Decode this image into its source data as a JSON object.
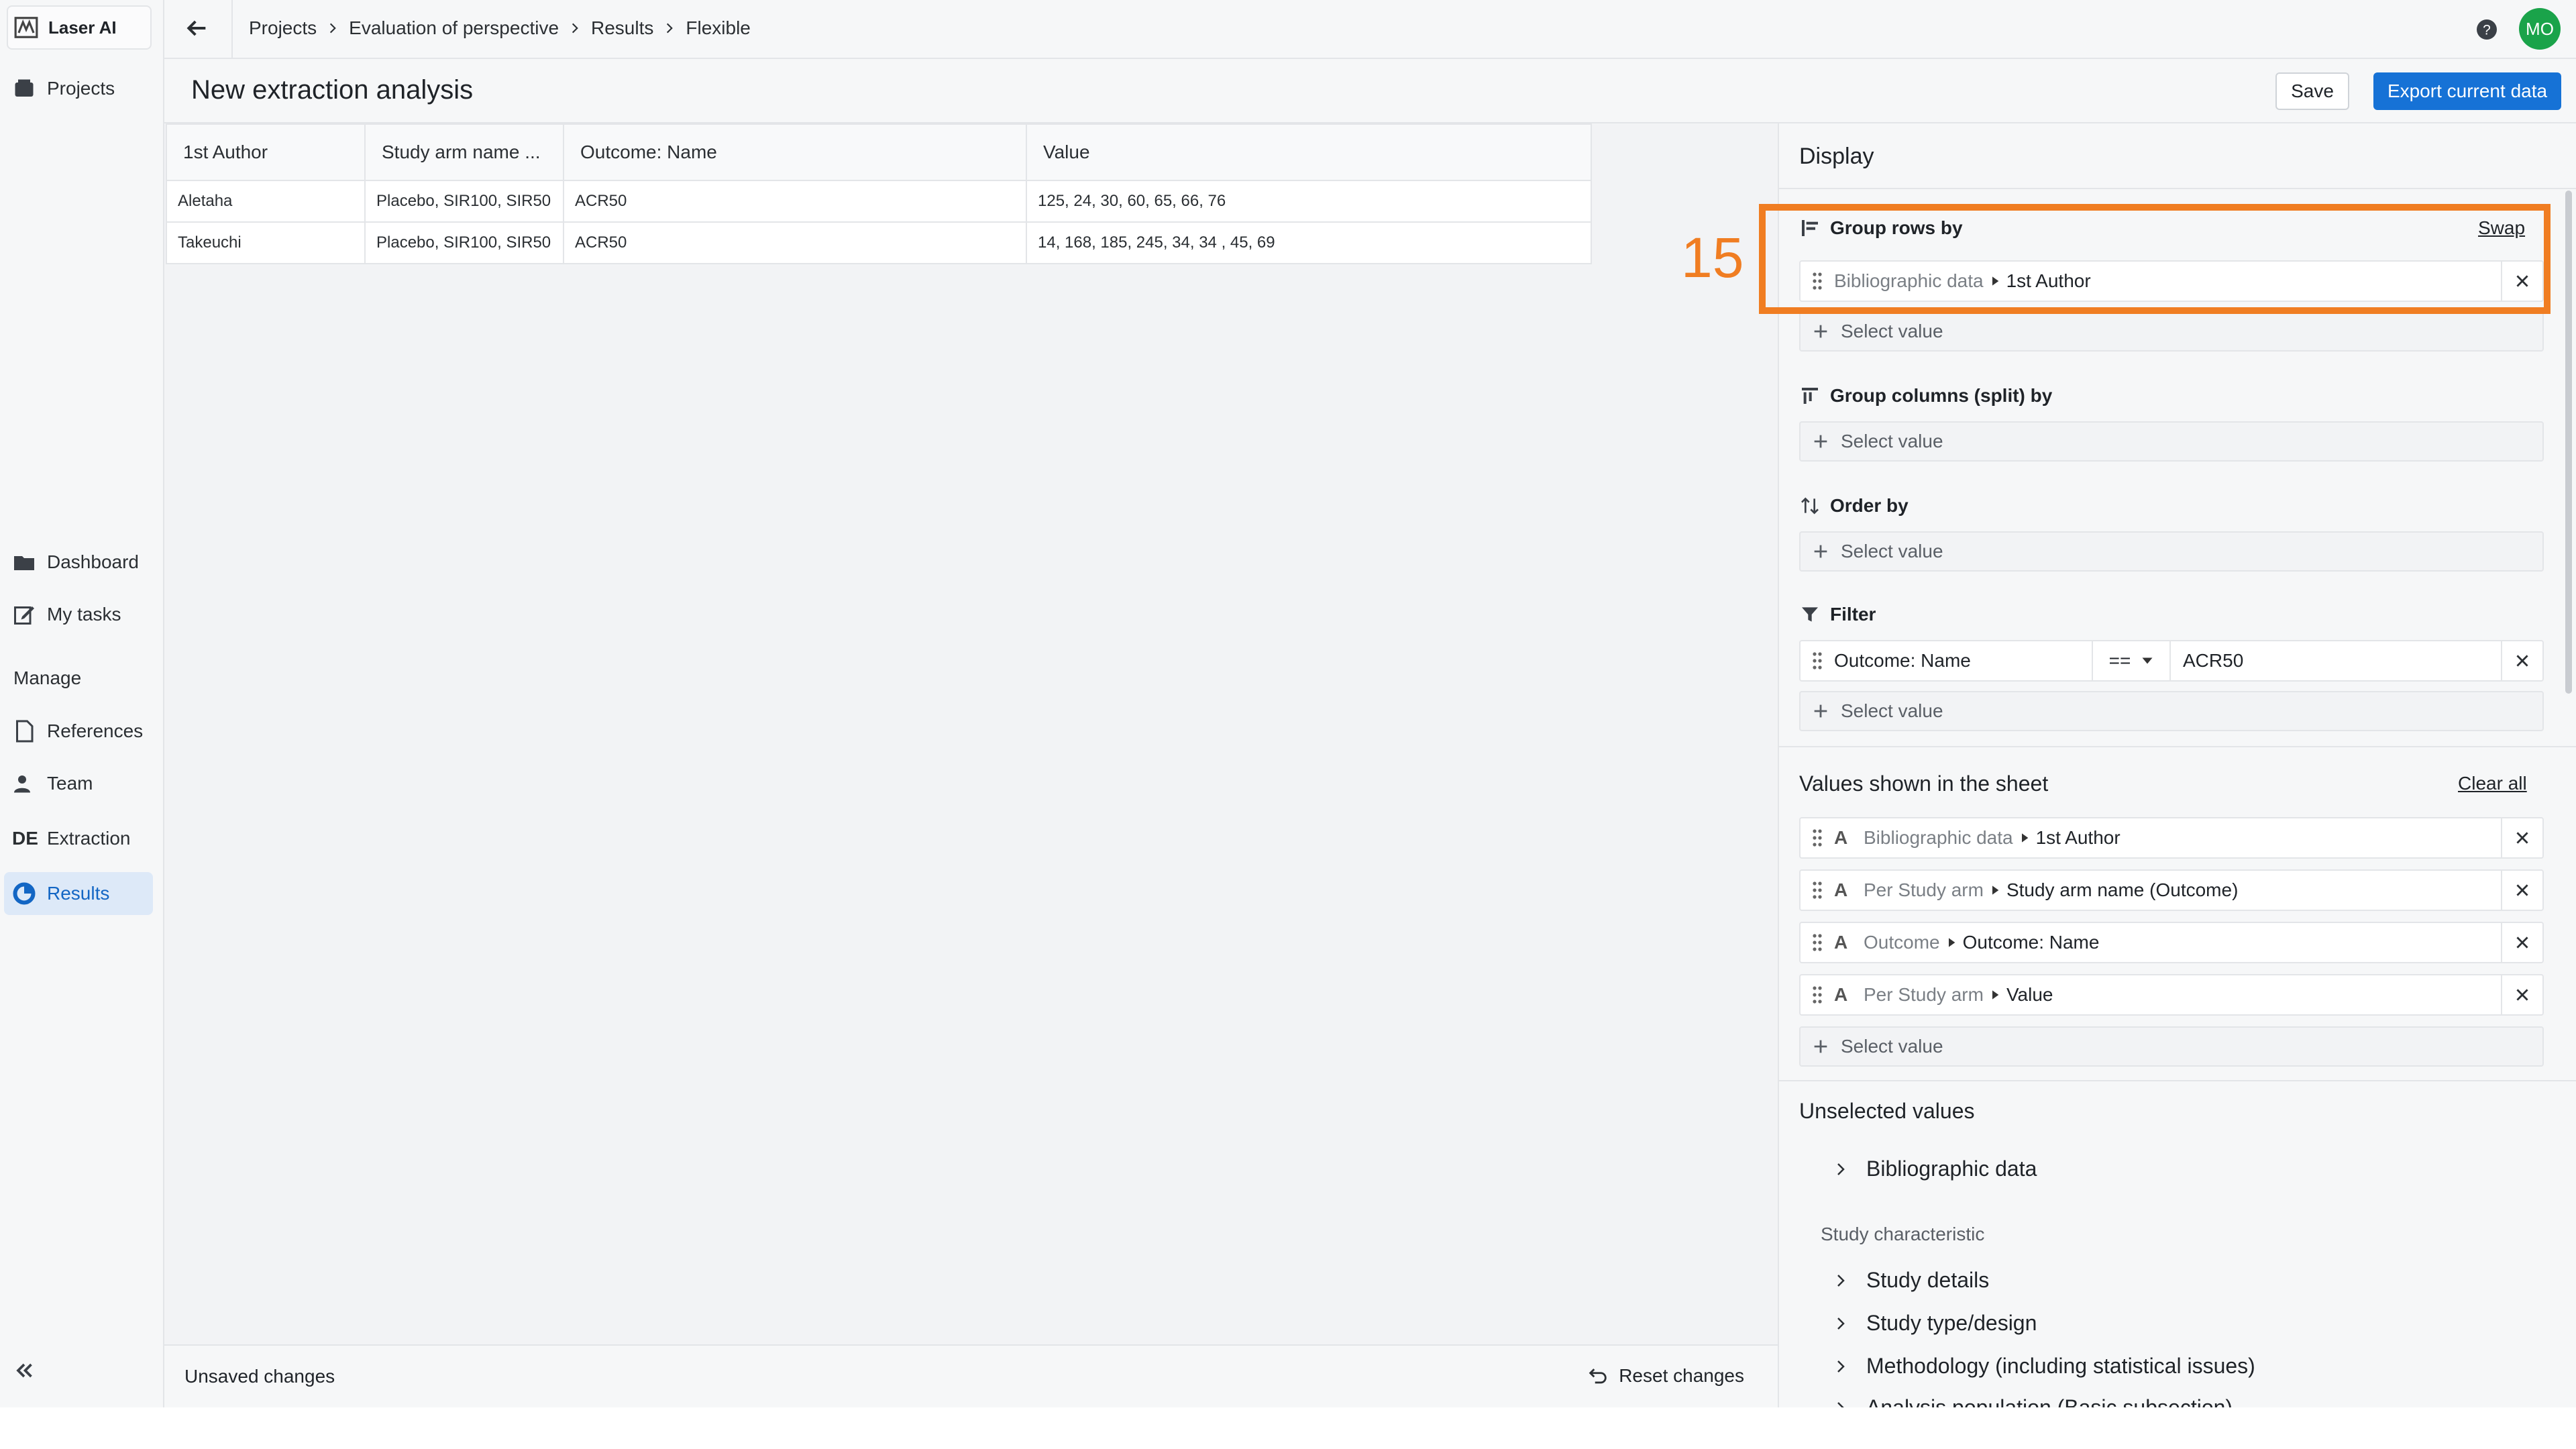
{
  "app": {
    "name": "Laser AI"
  },
  "sidebar": {
    "projects": "Projects",
    "dashboard": "Dashboard",
    "my_tasks": "My tasks",
    "manage_heading": "Manage",
    "references": "References",
    "team": "Team",
    "extraction_badge": "DE",
    "extraction": "Extraction",
    "results": "Results"
  },
  "breadcrumb": [
    "Projects",
    "Evaluation of perspective",
    "Results",
    "Flexible"
  ],
  "user": {
    "initials": "MO",
    "avatar_color": "#1aa34a"
  },
  "page": {
    "title": "New extraction analysis",
    "save_label": "Save",
    "export_label": "Export current data"
  },
  "table": {
    "headers": [
      "1st Author",
      "Study arm name ...",
      "Outcome: Name",
      "Value"
    ],
    "rows": [
      [
        "Aletaha",
        "Placebo, SIR100, SIR50",
        "ACR50",
        "125, 24, 30, 60, 65, 66, 76"
      ],
      [
        "Takeuchi",
        "Placebo, SIR100, SIR50",
        "ACR50",
        "14, 168, 185, 245, 34, 34 , 45, 69"
      ]
    ]
  },
  "footer": {
    "unsaved": "Unsaved changes",
    "reset": "Reset changes"
  },
  "display": {
    "title": "Display",
    "group_rows": {
      "title": "Group rows by",
      "swap": "Swap",
      "item_path": "Bibliographic data",
      "item_value": "1st Author",
      "add": "Select value"
    },
    "group_cols": {
      "title": "Group columns (split) by",
      "add": "Select value"
    },
    "order_by": {
      "title": "Order by",
      "add": "Select value"
    },
    "filter": {
      "title": "Filter",
      "field": "Outcome: Name",
      "operator": "==",
      "value": "ACR50",
      "add": "Select value"
    },
    "values": {
      "title": "Values shown in the sheet",
      "clear_all": "Clear all",
      "type_glyph": "A",
      "items": [
        {
          "path": "Bibliographic data",
          "value": "1st Author"
        },
        {
          "path": "Per Study arm",
          "value": "Study arm name (Outcome)"
        },
        {
          "path": "Outcome",
          "value": "Outcome: Name"
        },
        {
          "path": "Per Study arm",
          "value": "Value"
        }
      ],
      "add": "Select value"
    },
    "unselected": {
      "title": "Unselected values",
      "bibliographic": "Bibliographic data",
      "group_label": "Study characteristic",
      "items": [
        "Study details",
        "Study type/design",
        "Methodology (including statistical issues)",
        "Analysis population (Basic subsection)"
      ]
    }
  },
  "annotation": {
    "number": "15",
    "color": "#f07d22"
  },
  "colors": {
    "accent": "#1672d6",
    "active_bg": "#dde9f8"
  }
}
